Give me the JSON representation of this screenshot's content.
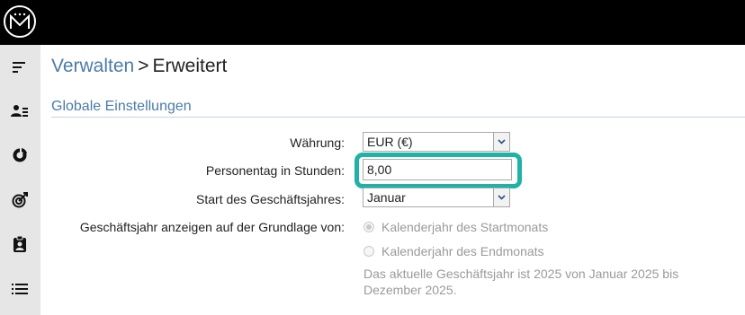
{
  "topbar": {
    "logo_icon": "monogram-logo-icon"
  },
  "sidebar": {
    "items": [
      {
        "icon": "collapse-menu-icon"
      },
      {
        "icon": "users-list-icon"
      },
      {
        "icon": "donut-chart-icon"
      },
      {
        "icon": "target-icon"
      },
      {
        "icon": "clipboard-user-icon"
      },
      {
        "icon": "list-icon"
      }
    ]
  },
  "breadcrumb": {
    "parent": "Verwalten",
    "separator": ">",
    "current": "Erweitert"
  },
  "section": {
    "title": "Globale Einstellungen"
  },
  "form": {
    "currency": {
      "label": "Währung:",
      "value": "EUR (€)"
    },
    "person_day_hours": {
      "label": "Personentag in Stunden:",
      "value": "8,00"
    },
    "fiscal_year_start": {
      "label": "Start des Geschäftsjahres:",
      "value": "Januar"
    },
    "fiscal_year_display": {
      "label": "Geschäftsjahr anzeigen auf der Grundlage von:",
      "options": [
        {
          "label": "Kalenderjahr des Startmonats",
          "selected": true
        },
        {
          "label": "Kalenderjahr des Endmonats",
          "selected": false
        }
      ],
      "note": "Das aktuelle Geschäftsjahr ist 2025 von Januar 2025 bis Dezember 2025."
    }
  },
  "colors": {
    "topbar": "#000000",
    "sidebar": "#e6e6e6",
    "accent_blue": "#4c7bab",
    "highlight_teal": "#1fb2a6",
    "muted_text": "#9a9a9a"
  }
}
